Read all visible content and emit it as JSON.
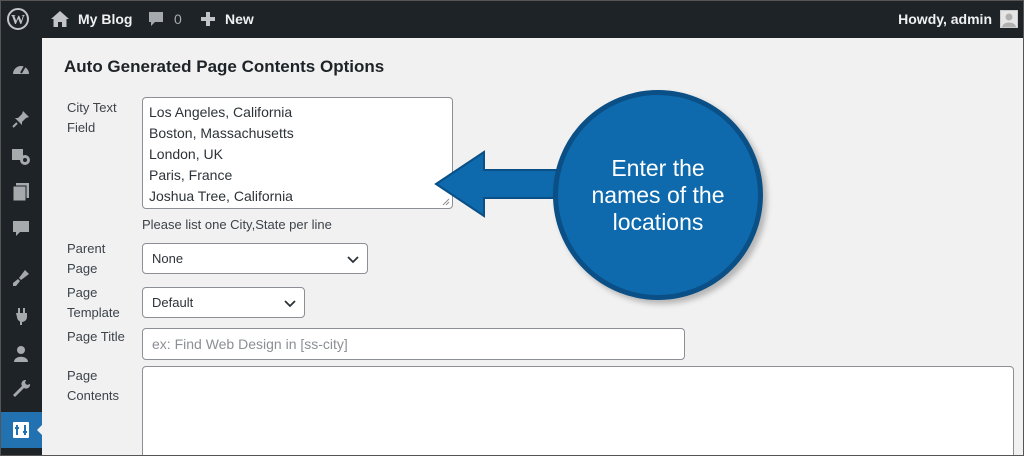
{
  "adminbar": {
    "site_name": "My Blog",
    "comments_count": "0",
    "new_label": "New",
    "howdy": "Howdy, admin"
  },
  "sidebar": {
    "icons": [
      "dashboard-icon",
      "pin-icon",
      "media-icon",
      "pages-icon",
      "comments-icon",
      "appearance-icon",
      "plugins-icon",
      "users-icon",
      "tools-icon",
      "settings-icon"
    ],
    "active": "settings-icon"
  },
  "main": {
    "heading": "Auto Generated Page Contents Options",
    "city_field": {
      "label_line1": "City Text",
      "label_line2": "Field",
      "lines": [
        "Los Angeles, California",
        "Boston, Massachusetts",
        "London, UK",
        "Paris, France",
        "Joshua Tree, California"
      ],
      "hint": "Please list one City,State per line"
    },
    "parent_page": {
      "label_line1": "Parent",
      "label_line2": "Page",
      "value": "None"
    },
    "page_template": {
      "label_line1": "Page",
      "label_line2": "Template",
      "value": "Default"
    },
    "page_title": {
      "label": "Page Title",
      "placeholder": "ex: Find Web Design in [ss-city]"
    },
    "page_contents": {
      "label_line1": "Page",
      "label_line2": "Contents",
      "value": ""
    }
  },
  "callout": {
    "line1": "Enter the",
    "line2": "names of the",
    "line3": "locations",
    "color": "#0e6aad"
  }
}
